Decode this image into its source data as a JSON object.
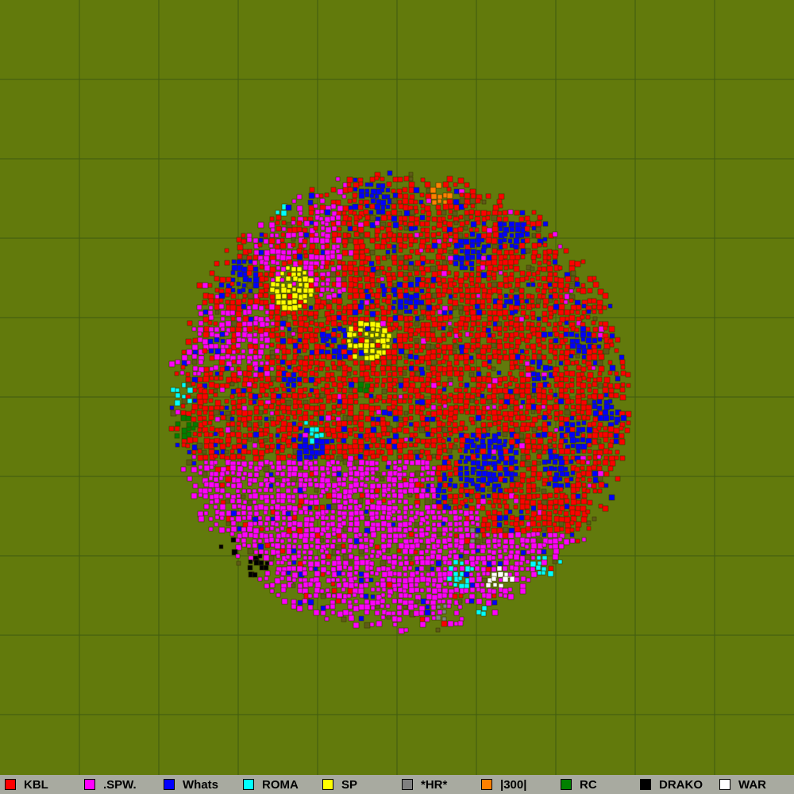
{
  "map": {
    "background_color": "#627a0c",
    "grid_color": "#3f5a10",
    "grid_divisions": 10,
    "border_color": "#3a3a00"
  },
  "legend": {
    "background_color": "#a8aaa0",
    "items": [
      {
        "label": "KBL",
        "color": "#ff0000",
        "icon": "red-swatch-icon"
      },
      {
        "label": ".SPW.",
        "color": "#ff00ff",
        "icon": "magenta-swatch-icon"
      },
      {
        "label": "Whats",
        "color": "#0000ff",
        "icon": "blue-swatch-icon"
      },
      {
        "label": "ROMA",
        "color": "#00ffff",
        "icon": "cyan-swatch-icon"
      },
      {
        "label": "SP",
        "color": "#ffff00",
        "icon": "yellow-swatch-icon"
      },
      {
        "label": "*HR*",
        "color": "#808080",
        "icon": "gray-swatch-icon"
      },
      {
        "label": "|300|",
        "color": "#ff8000",
        "icon": "orange-swatch-icon"
      },
      {
        "label": "RC",
        "color": "#008000",
        "icon": "green-swatch-icon"
      },
      {
        "label": "DRAKO",
        "color": "#000000",
        "icon": "black-swatch-icon"
      },
      {
        "label": "WAR",
        "color": "#ffffff",
        "icon": "white-swatch-icon"
      }
    ]
  }
}
